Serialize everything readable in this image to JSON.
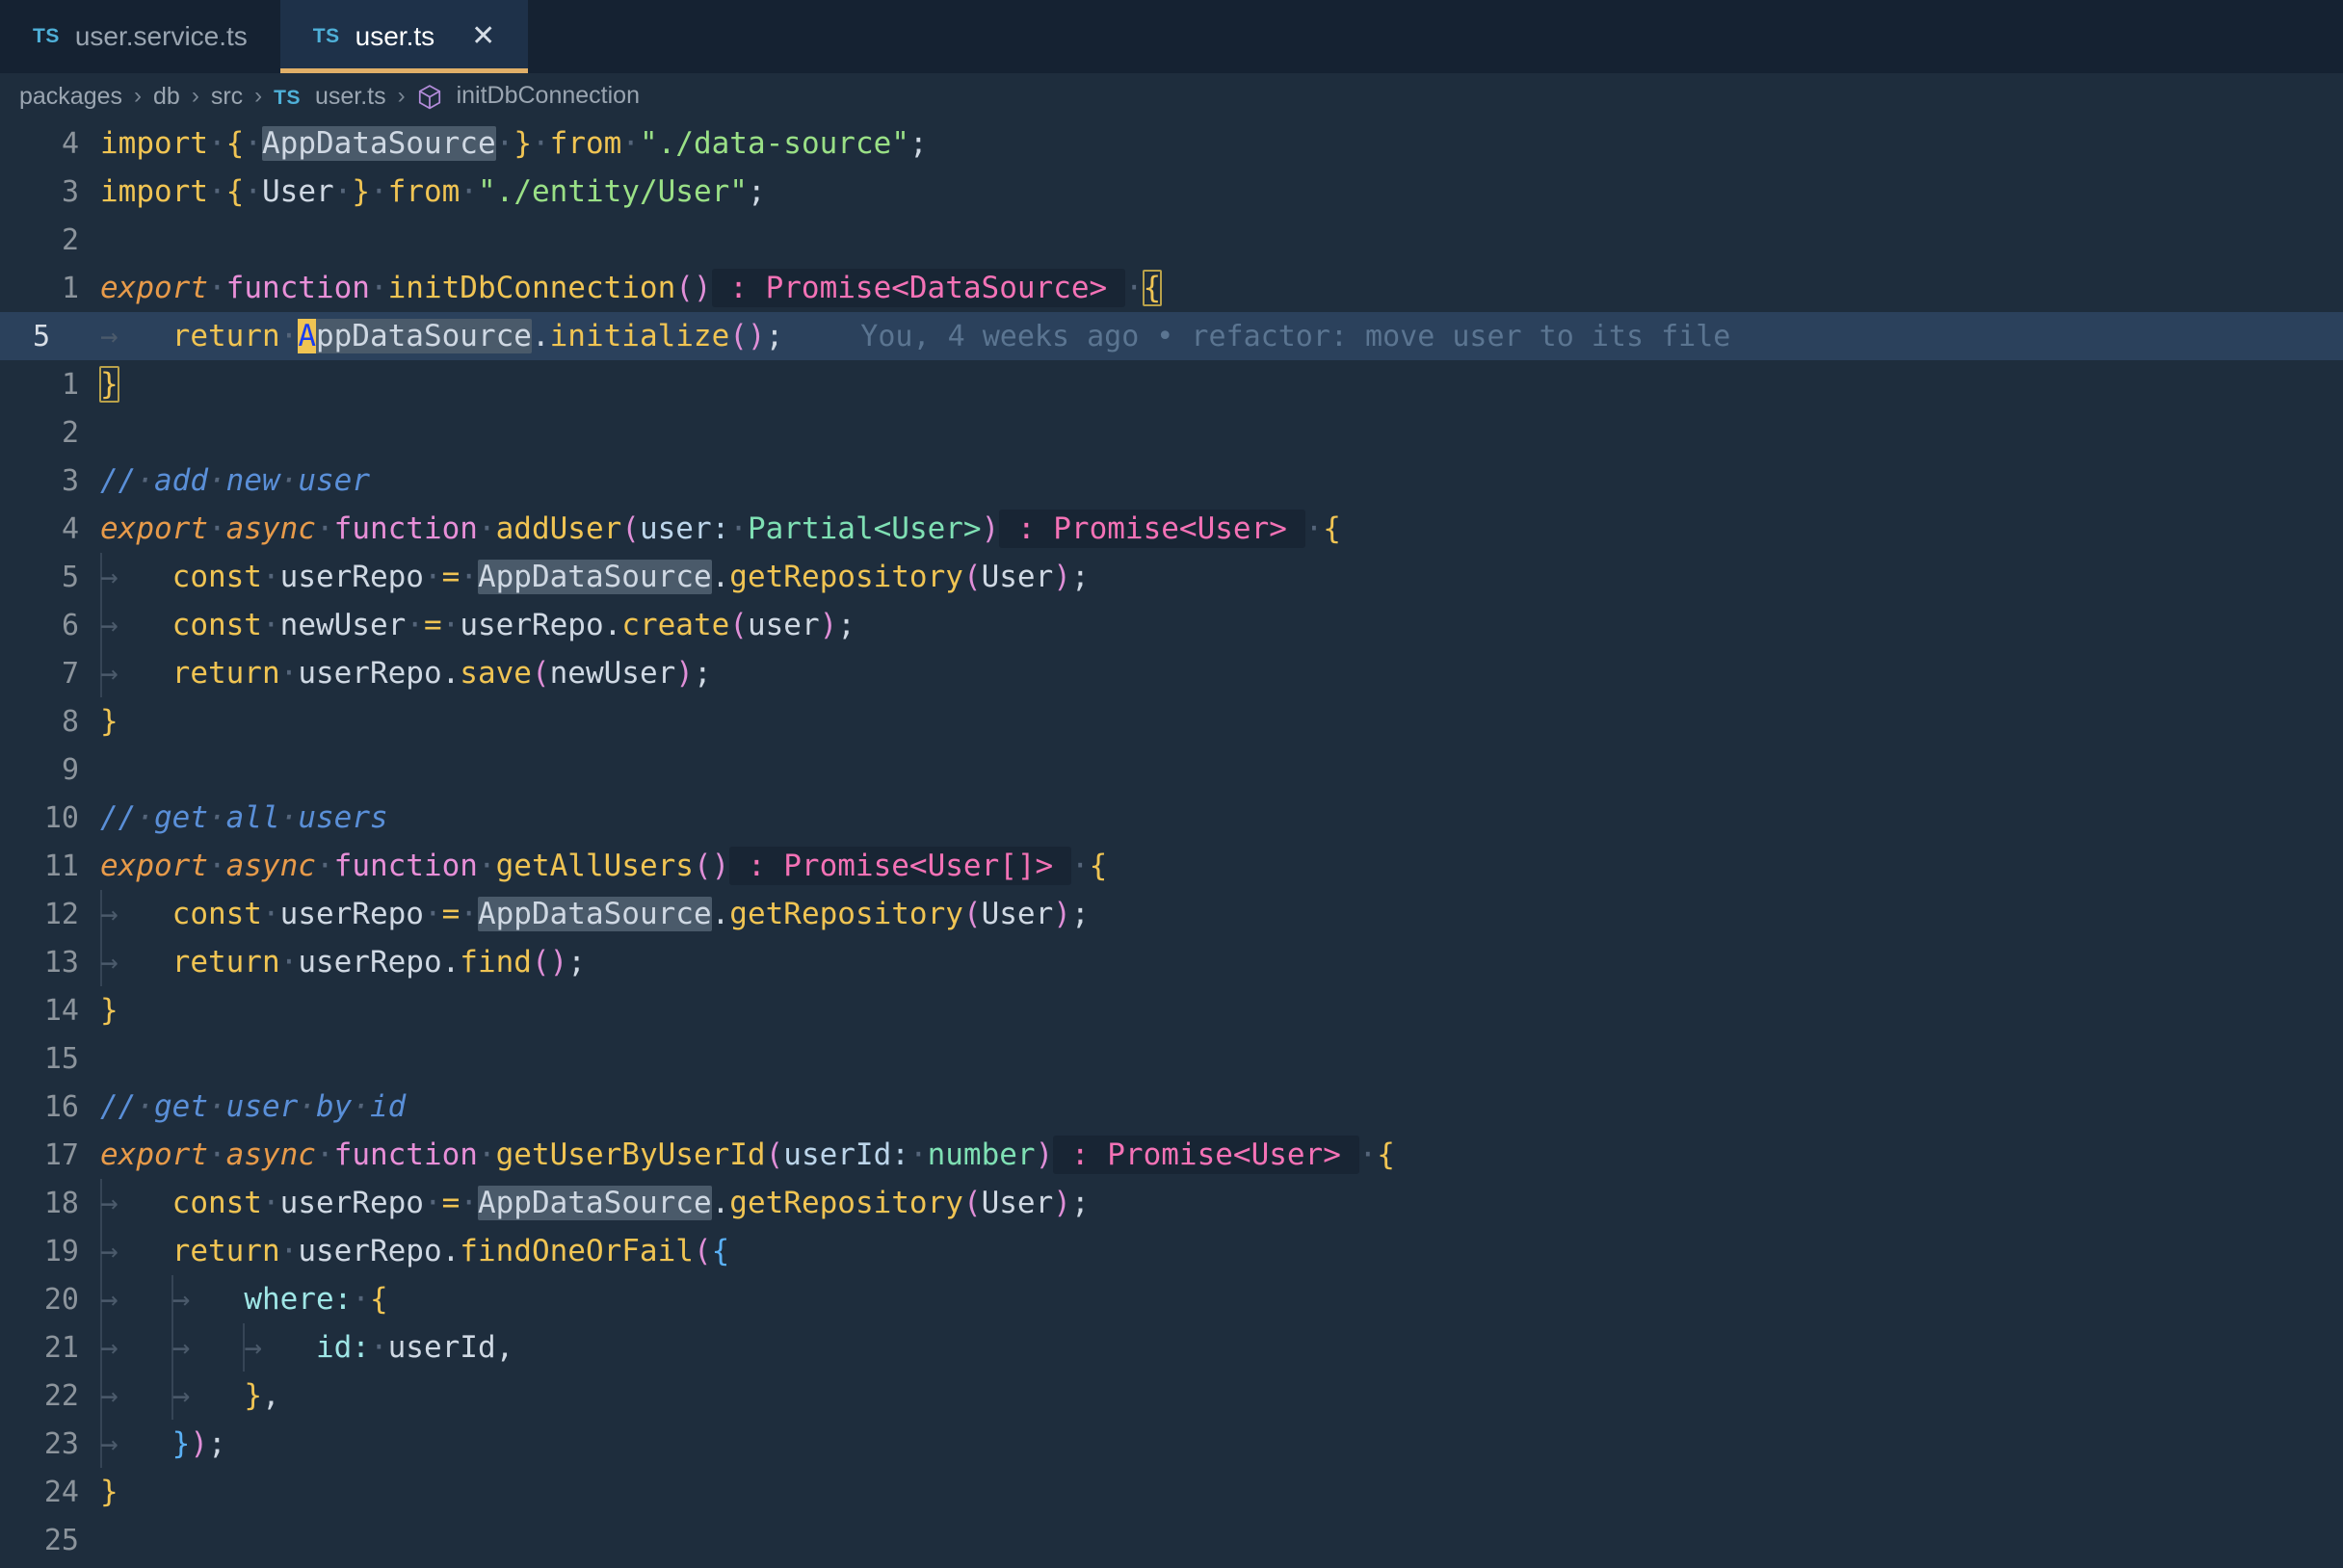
{
  "window": {
    "title": "user.ts"
  },
  "tabs": [
    {
      "icon": "typescript-file-icon",
      "badge": "TS",
      "label": "user.service.ts",
      "active": false,
      "closable": false
    },
    {
      "icon": "typescript-file-icon",
      "badge": "TS",
      "label": "user.ts",
      "active": true,
      "closable": true,
      "close_glyph": "✕"
    }
  ],
  "breadcrumb": {
    "separator": "›",
    "items": [
      {
        "label": "packages",
        "icon": null
      },
      {
        "label": "db",
        "icon": null
      },
      {
        "label": "src",
        "icon": null
      },
      {
        "label": "user.ts",
        "icon": "typescript-file-icon",
        "badge": "TS"
      },
      {
        "label": "initDbConnection",
        "icon": "symbol-function-cube-icon"
      }
    ]
  },
  "editor": {
    "language": "typescript",
    "relative_line_numbers": true,
    "current_line_number": "5",
    "cursor_char": "A",
    "blame": {
      "author": "You",
      "when": "4 weeks ago",
      "separator": "•",
      "message": "refactor: move user to its file",
      "full_text": "You, 4 weeks ago • refactor: move user to its file"
    },
    "whitespace_dot": "·",
    "tab_arrow": "→",
    "lines": [
      {
        "num": "4",
        "current": false
      },
      {
        "num": "3",
        "current": false
      },
      {
        "num": "2",
        "current": false
      },
      {
        "num": "1",
        "current": false
      },
      {
        "num": "5",
        "current": true
      },
      {
        "num": "1",
        "current": false
      },
      {
        "num": "2",
        "current": false
      },
      {
        "num": "3",
        "current": false
      },
      {
        "num": "4",
        "current": false
      },
      {
        "num": "5",
        "current": false
      },
      {
        "num": "6",
        "current": false
      },
      {
        "num": "7",
        "current": false
      },
      {
        "num": "8",
        "current": false
      },
      {
        "num": "9",
        "current": false
      },
      {
        "num": "10",
        "current": false
      },
      {
        "num": "11",
        "current": false
      },
      {
        "num": "12",
        "current": false
      },
      {
        "num": "13",
        "current": false
      },
      {
        "num": "14",
        "current": false
      },
      {
        "num": "15",
        "current": false
      },
      {
        "num": "16",
        "current": false
      },
      {
        "num": "17",
        "current": false
      },
      {
        "num": "18",
        "current": false
      },
      {
        "num": "19",
        "current": false
      },
      {
        "num": "20",
        "current": false
      },
      {
        "num": "21",
        "current": false
      },
      {
        "num": "22",
        "current": false
      },
      {
        "num": "23",
        "current": false
      },
      {
        "num": "24",
        "current": false
      },
      {
        "num": "25",
        "current": false
      }
    ],
    "source_text": [
      "import { AppDataSource } from \"./data-source\";",
      "import { User } from \"./entity/User\";",
      "",
      "export function initDbConnection(): Promise<DataSource> {",
      "\treturn AppDataSource.initialize();",
      "}",
      "",
      "// add new user",
      "export async function addUser(user: Partial<User>): Promise<User> {",
      "\tconst userRepo = AppDataSource.getRepository(User);",
      "\tconst newUser = userRepo.create(user);",
      "\treturn userRepo.save(newUser);",
      "}",
      "",
      "// get all users",
      "export async function getAllUsers(): Promise<User[]> {",
      "\tconst userRepo = AppDataSource.getRepository(User);",
      "\treturn userRepo.find();",
      "}",
      "",
      "// get user by id",
      "export async function getUserByUserId(userId: number): Promise<User> {",
      "\tconst userRepo = AppDataSource.getRepository(User);",
      "\treturn userRepo.findOneOrFail({",
      "\t\twhere: {",
      "\t\t\tid: userId,",
      "\t\t},",
      "\t});",
      "}",
      ""
    ]
  },
  "colors": {
    "background": "#1e2d3d",
    "tabbar_background": "#152232",
    "active_tab_background": "#1e3149",
    "active_tab_border": "#e0af68",
    "current_line": "#2b415c",
    "occurrence_highlight": "#4a5a6a",
    "inlay_hint_background": "#182534",
    "keyword": "#f0c453",
    "export_keyword": "#e79a4a",
    "function_keyword": "#e88fd8",
    "string": "#9ae086",
    "comment": "#5a8fd8",
    "type": "#f472b6",
    "blame_text": "#5b7591",
    "cursor": "#f0c453"
  }
}
